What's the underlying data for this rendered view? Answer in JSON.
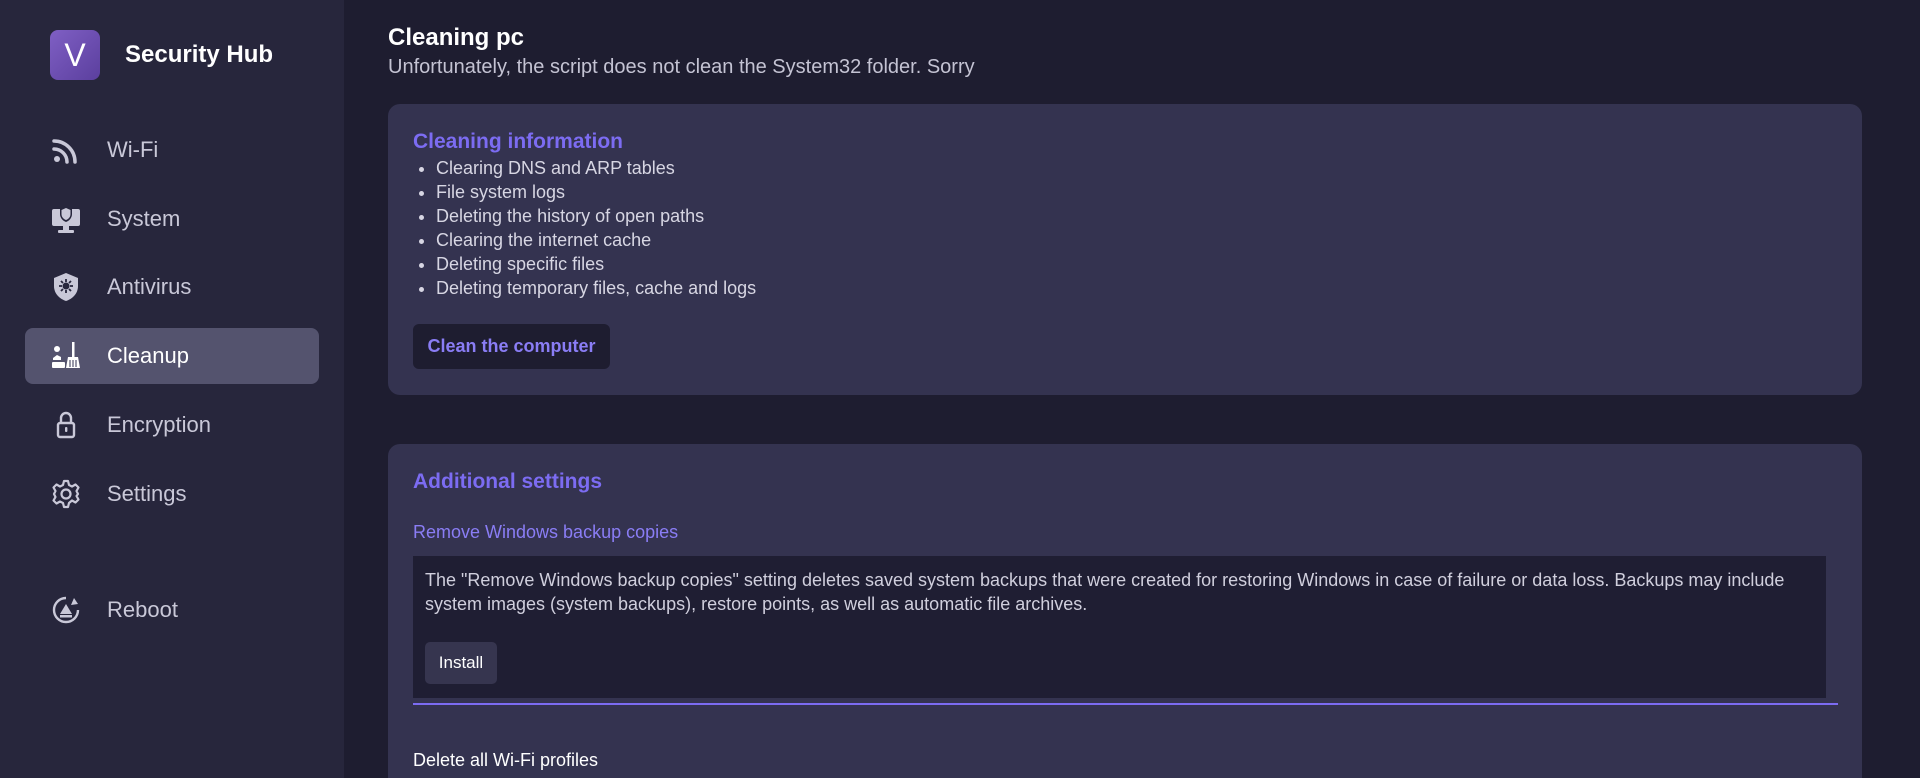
{
  "app": {
    "logo_letter": "V",
    "name": "Security Hub",
    "accent_color": "#7c6cf2"
  },
  "sidebar": {
    "items": [
      {
        "label": "Wi-Fi",
        "icon": "wifi-icon",
        "active": false
      },
      {
        "label": "System",
        "icon": "monitor-shield-icon",
        "active": false
      },
      {
        "label": "Antivirus",
        "icon": "shield-virus-icon",
        "active": false
      },
      {
        "label": "Cleanup",
        "icon": "broom-icon",
        "active": true
      },
      {
        "label": "Encryption",
        "icon": "lock-icon",
        "active": false
      },
      {
        "label": "Settings",
        "icon": "gear-icon",
        "active": false
      }
    ],
    "reboot": {
      "label": "Reboot",
      "icon": "reboot-icon"
    }
  },
  "main": {
    "title": "Cleaning pc",
    "subtitle": "Unfortunately, the script does not clean the System32 folder. Sorry",
    "info_card": {
      "title": "Cleaning information",
      "items": [
        "Clearing DNS and ARP tables",
        "File system logs",
        "Deleting the history of open paths",
        "Clearing the internet cache",
        "Deleting specific files",
        "Deleting temporary files, cache and logs"
      ],
      "button_label": "Clean the computer"
    },
    "additional": {
      "title": "Additional settings",
      "setting1": {
        "label": "Remove Windows backup copies",
        "description": "The \"Remove Windows backup copies\" setting deletes saved system backups that were created for restoring Windows in case of failure or data loss. Backups may include system images (system backups), restore points, as well as automatic file archives.",
        "button_label": "Install"
      },
      "setting2": {
        "label": "Delete all Wi-Fi profiles"
      }
    }
  }
}
